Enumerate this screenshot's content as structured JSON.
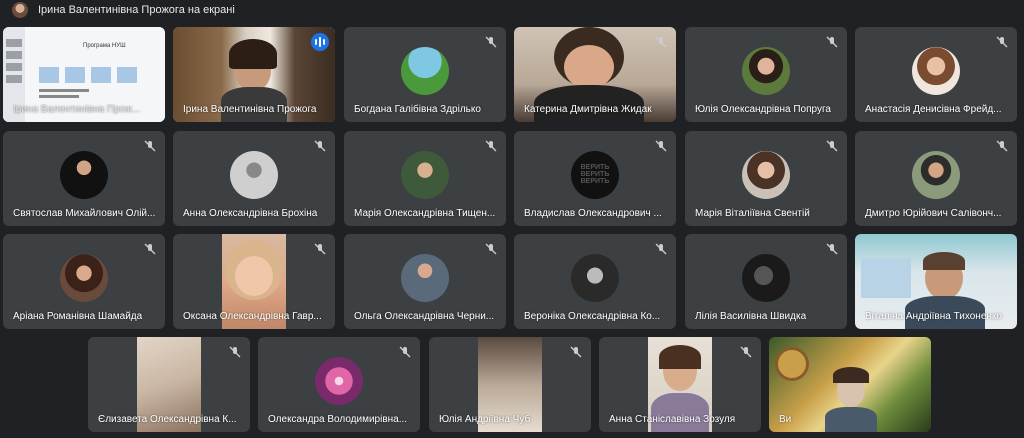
{
  "header": {
    "title": "Ірина Валентинівна Прожога на екрані"
  },
  "slide": {
    "title": "Програма НУШ"
  },
  "tiles": [
    {
      "name": "Ірина Валентинівна Прож..."
    },
    {
      "name": "Ірина Валентинівна Прожога"
    },
    {
      "name": "Богдана Галібівна Здрілько"
    },
    {
      "name": "Катерина Дмитрівна Жидак"
    },
    {
      "name": "Юлія Олександрівна Попруга"
    },
    {
      "name": "Анастасія Денисівна Фрейд..."
    },
    {
      "name": "Святослав Михайлович Олій..."
    },
    {
      "name": "Анна Олександрівна Брохіна"
    },
    {
      "name": "Марія Олександрівна Тищен..."
    },
    {
      "name": "Владислав Олександрович ..."
    },
    {
      "name": "Марія Віталіївна Свентій"
    },
    {
      "name": "Дмитро Юрійович Салівонч..."
    },
    {
      "name": "Аріана Романівна Шамайда"
    },
    {
      "name": "Оксана Олександрівна Гавр..."
    },
    {
      "name": "Ольга Олександрівна Черни..."
    },
    {
      "name": "Вероніка Олександрівна Ко..."
    },
    {
      "name": "Лілія Василівна Швидка"
    },
    {
      "name": "Віталіна Андріївна Тихоненко"
    },
    {
      "name": "Єлизавета Олександрівна К..."
    },
    {
      "name": "Олександра Володимирівна..."
    },
    {
      "name": "Юлія Андріївна Чуб"
    },
    {
      "name": "Анна Станіславівна Зозуля"
    },
    {
      "name": "Ви"
    }
  ],
  "avatar_text": {
    "verity": "ВЕРИТЬ"
  },
  "colors": {
    "tile": "#3c4043",
    "background": "#202124",
    "accent": "#1a73e8",
    "highlight": "#8ab4f8"
  }
}
